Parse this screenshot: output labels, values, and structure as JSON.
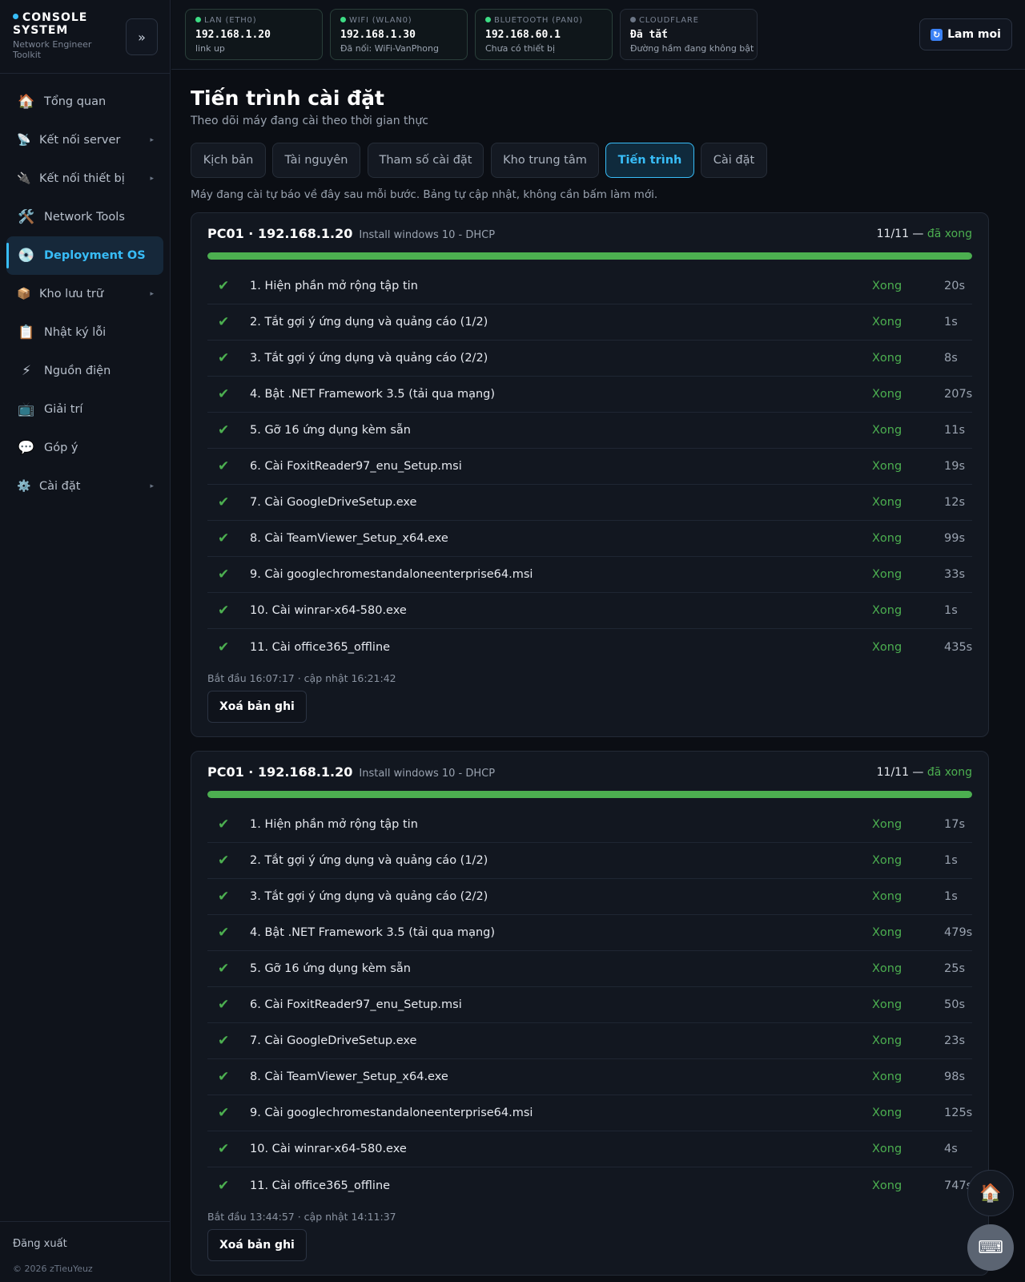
{
  "brand": {
    "title": "CONSOLE SYSTEM",
    "subtitle": "Network Engineer Toolkit",
    "collapse_glyph": "»"
  },
  "nav": [
    {
      "label": "Tổng quan",
      "icon": "home-icon",
      "glyph": "🏠",
      "chevron": false
    },
    {
      "label": "Kết nối server",
      "icon": "satellite-icon",
      "glyph": "📡",
      "chevron": true
    },
    {
      "label": "Kết nối thiết bị",
      "icon": "plug-icon",
      "glyph": "🔌",
      "chevron": true
    },
    {
      "label": "Network Tools",
      "icon": "tools-icon",
      "glyph": "🛠️",
      "chevron": false
    },
    {
      "label": "Deployment OS",
      "icon": "disc-icon",
      "glyph": "💿",
      "chevron": false,
      "active": true
    },
    {
      "label": "Kho lưu trữ",
      "icon": "package-icon",
      "glyph": "📦",
      "chevron": true
    },
    {
      "label": "Nhật ký lỗi",
      "icon": "clipboard-icon",
      "glyph": "📋",
      "chevron": false
    },
    {
      "label": "Nguồn điện",
      "icon": "lightning-icon",
      "glyph": "⚡",
      "chevron": false
    },
    {
      "label": "Giải trí",
      "icon": "tv-icon",
      "glyph": "📺",
      "chevron": false
    },
    {
      "label": "Góp ý",
      "icon": "speech-bubble-icon",
      "glyph": "💬",
      "chevron": false
    },
    {
      "label": "Cài đặt",
      "icon": "gear-icon",
      "glyph": "⚙️",
      "chevron": true
    }
  ],
  "footer": {
    "logout": "Đăng xuất",
    "copyright": "© 2026 zTieuYeuz"
  },
  "network": [
    {
      "label": "LAN (ETH0)",
      "value": "192.168.1.20",
      "sub": "link up",
      "status": "up"
    },
    {
      "label": "WIFI (WLAN0)",
      "value": "192.168.1.30",
      "sub": "Đã nối: WiFi-VanPhong",
      "status": "up"
    },
    {
      "label": "BLUETOOTH (PAN0)",
      "value": "192.168.60.1",
      "sub": "Chưa có thiết bị",
      "status": "up"
    },
    {
      "label": "CLOUDFLARE",
      "value": "Đã tắt",
      "sub": "Đường hầm đang không bật",
      "status": "off"
    }
  ],
  "refresh": {
    "label": "Lam moi",
    "icon": "refresh-icon"
  },
  "page": {
    "title": "Tiến trình cài đặt",
    "subtitle": "Theo dõi máy đang cài theo thời gian thực",
    "hint": "Máy đang cài tự báo về đây sau mỗi bước. Bảng tự cập nhật, không cần bấm làm mới."
  },
  "tabs": [
    {
      "label": "Kịch bản"
    },
    {
      "label": "Tài nguyên"
    },
    {
      "label": "Tham số cài đặt"
    },
    {
      "label": "Kho trung tâm"
    },
    {
      "label": "Tiến trình",
      "active": true
    },
    {
      "label": "Cài đặt"
    }
  ],
  "colors": {
    "accent": "#38bdf8",
    "success": "#4caf50",
    "background": "#0b0e14"
  },
  "jobs": [
    {
      "host": "PC01 · 192.168.1.20",
      "script": "Install windows 10 - DHCP",
      "progress_text": "11/11 —",
      "state": "đã xong",
      "progress_fraction": 1.0,
      "steps": [
        {
          "name": "1. Hiện phần mở rộng tập tin",
          "status": "Xong",
          "time": "20s"
        },
        {
          "name": "2. Tắt gợi ý ứng dụng và quảng cáo (1/2)",
          "status": "Xong",
          "time": "1s"
        },
        {
          "name": "3. Tắt gợi ý ứng dụng và quảng cáo (2/2)",
          "status": "Xong",
          "time": "8s"
        },
        {
          "name": "4. Bật .NET Framework 3.5 (tải qua mạng)",
          "status": "Xong",
          "time": "207s"
        },
        {
          "name": "5. Gỡ 16 ứng dụng kèm sẵn",
          "status": "Xong",
          "time": "11s"
        },
        {
          "name": "6. Cài FoxitReader97_enu_Setup.msi",
          "status": "Xong",
          "time": "19s"
        },
        {
          "name": "7. Cài GoogleDriveSetup.exe",
          "status": "Xong",
          "time": "12s"
        },
        {
          "name": "8. Cài TeamViewer_Setup_x64.exe",
          "status": "Xong",
          "time": "99s"
        },
        {
          "name": "9. Cài googlechromestandaloneenterprise64.msi",
          "status": "Xong",
          "time": "33s"
        },
        {
          "name": "10. Cài winrar-x64-580.exe",
          "status": "Xong",
          "time": "1s"
        },
        {
          "name": "11. Cài office365_offline",
          "status": "Xong",
          "time": "435s"
        }
      ],
      "meta": "Bắt đầu 16:07:17 · cập nhật 16:21:42",
      "clear_label": "Xoá bản ghi"
    },
    {
      "host": "PC01 · 192.168.1.20",
      "script": "Install windows 10 - DHCP",
      "progress_text": "11/11 —",
      "state": "đã xong",
      "progress_fraction": 1.0,
      "steps": [
        {
          "name": "1. Hiện phần mở rộng tập tin",
          "status": "Xong",
          "time": "17s"
        },
        {
          "name": "2. Tắt gợi ý ứng dụng và quảng cáo (1/2)",
          "status": "Xong",
          "time": "1s"
        },
        {
          "name": "3. Tắt gợi ý ứng dụng và quảng cáo (2/2)",
          "status": "Xong",
          "time": "1s"
        },
        {
          "name": "4. Bật .NET Framework 3.5 (tải qua mạng)",
          "status": "Xong",
          "time": "479s"
        },
        {
          "name": "5. Gỡ 16 ứng dụng kèm sẵn",
          "status": "Xong",
          "time": "25s"
        },
        {
          "name": "6. Cài FoxitReader97_enu_Setup.msi",
          "status": "Xong",
          "time": "50s"
        },
        {
          "name": "7. Cài GoogleDriveSetup.exe",
          "status": "Xong",
          "time": "23s"
        },
        {
          "name": "8. Cài TeamViewer_Setup_x64.exe",
          "status": "Xong",
          "time": "98s"
        },
        {
          "name": "9. Cài googlechromestandaloneenterprise64.msi",
          "status": "Xong",
          "time": "125s"
        },
        {
          "name": "10. Cài winrar-x64-580.exe",
          "status": "Xong",
          "time": "4s"
        },
        {
          "name": "11. Cài office365_offline",
          "status": "Xong",
          "time": "747s"
        }
      ],
      "meta": "Bắt đầu 13:44:57 · cập nhật 14:11:37",
      "clear_label": "Xoá bản ghi"
    }
  ],
  "fabs": [
    {
      "icon": "home-icon",
      "glyph": "🏠"
    },
    {
      "icon": "keyboard-icon",
      "glyph": "⌨"
    }
  ]
}
